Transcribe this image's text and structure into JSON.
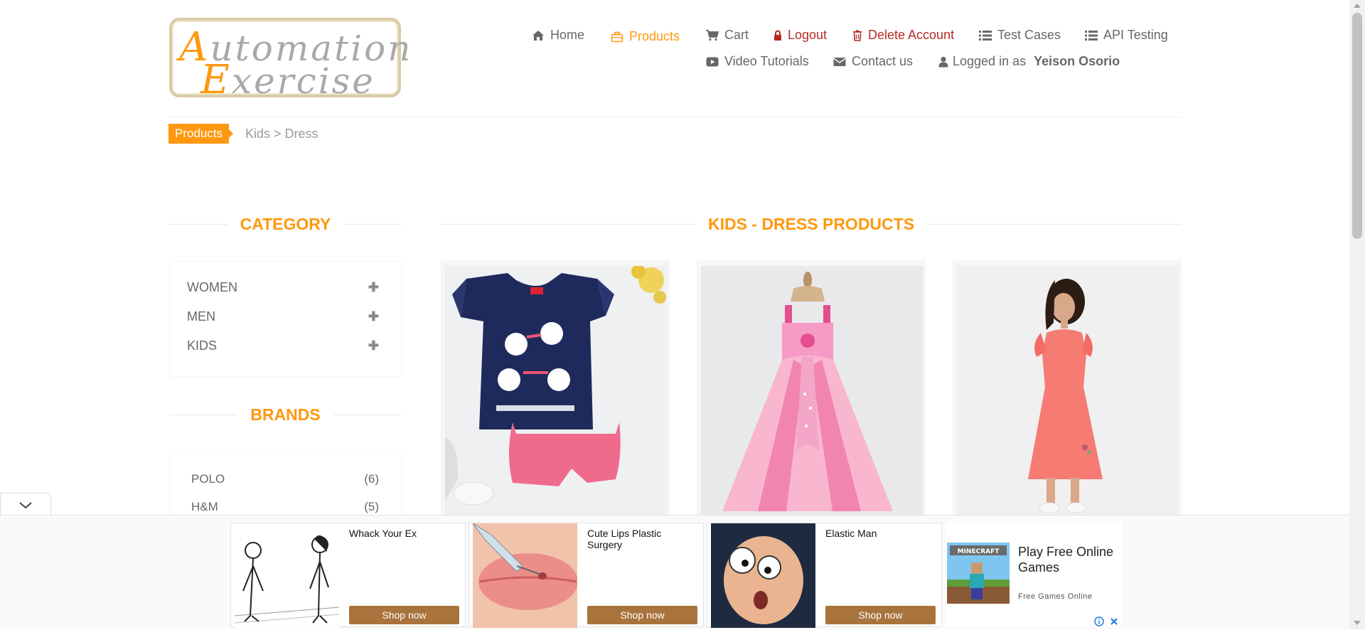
{
  "logo": {
    "line1": "Automation",
    "line2": "Exercise"
  },
  "nav": {
    "row1": [
      {
        "label": "Home",
        "icon": "home-icon"
      },
      {
        "label": "Products",
        "icon": "briefcase-icon",
        "active": true
      },
      {
        "label": "Cart",
        "icon": "cart-icon"
      },
      {
        "label": "Logout",
        "icon": "lock-icon",
        "accent": "#b52a22"
      },
      {
        "label": "Delete Account",
        "icon": "trash-icon",
        "accent": "#b52a22"
      },
      {
        "label": "Test Cases",
        "icon": "list-icon"
      },
      {
        "label": "API Testing",
        "icon": "list-icon"
      }
    ],
    "row2": [
      {
        "label": "Video Tutorials",
        "icon": "youtube-icon"
      },
      {
        "label": "Contact us",
        "icon": "envelope-icon"
      },
      {
        "label": "Logged in as",
        "icon": "user-icon",
        "user": "Yeison Osorio"
      }
    ]
  },
  "breadcrumb": {
    "tag": "Products",
    "path": "Kids > Dress"
  },
  "sidebar": {
    "category_title": "Category",
    "categories": [
      "WOMEN",
      "MEN",
      "KIDS"
    ],
    "brands_title": "Brands",
    "brands": [
      {
        "name": "POLO",
        "count": "(6)"
      },
      {
        "name": "H&M",
        "count": "(5)"
      }
    ]
  },
  "main": {
    "title": "Kids - Dress Products"
  },
  "ads": [
    {
      "title": "Whack Your Ex",
      "button": "Shop now"
    },
    {
      "title": "Cute Lips Plastic Surgery",
      "button": "Shop now"
    },
    {
      "title": "Elastic Man",
      "button": "Shop now"
    }
  ],
  "ad_last": {
    "title": "Play Free Online Games",
    "sub": "Free Games Online",
    "badge": "MINECRAFT"
  },
  "colors": {
    "accent": "#fe980f",
    "danger": "#b52a22",
    "text": "#696763",
    "ad_button": "#a9733d"
  }
}
